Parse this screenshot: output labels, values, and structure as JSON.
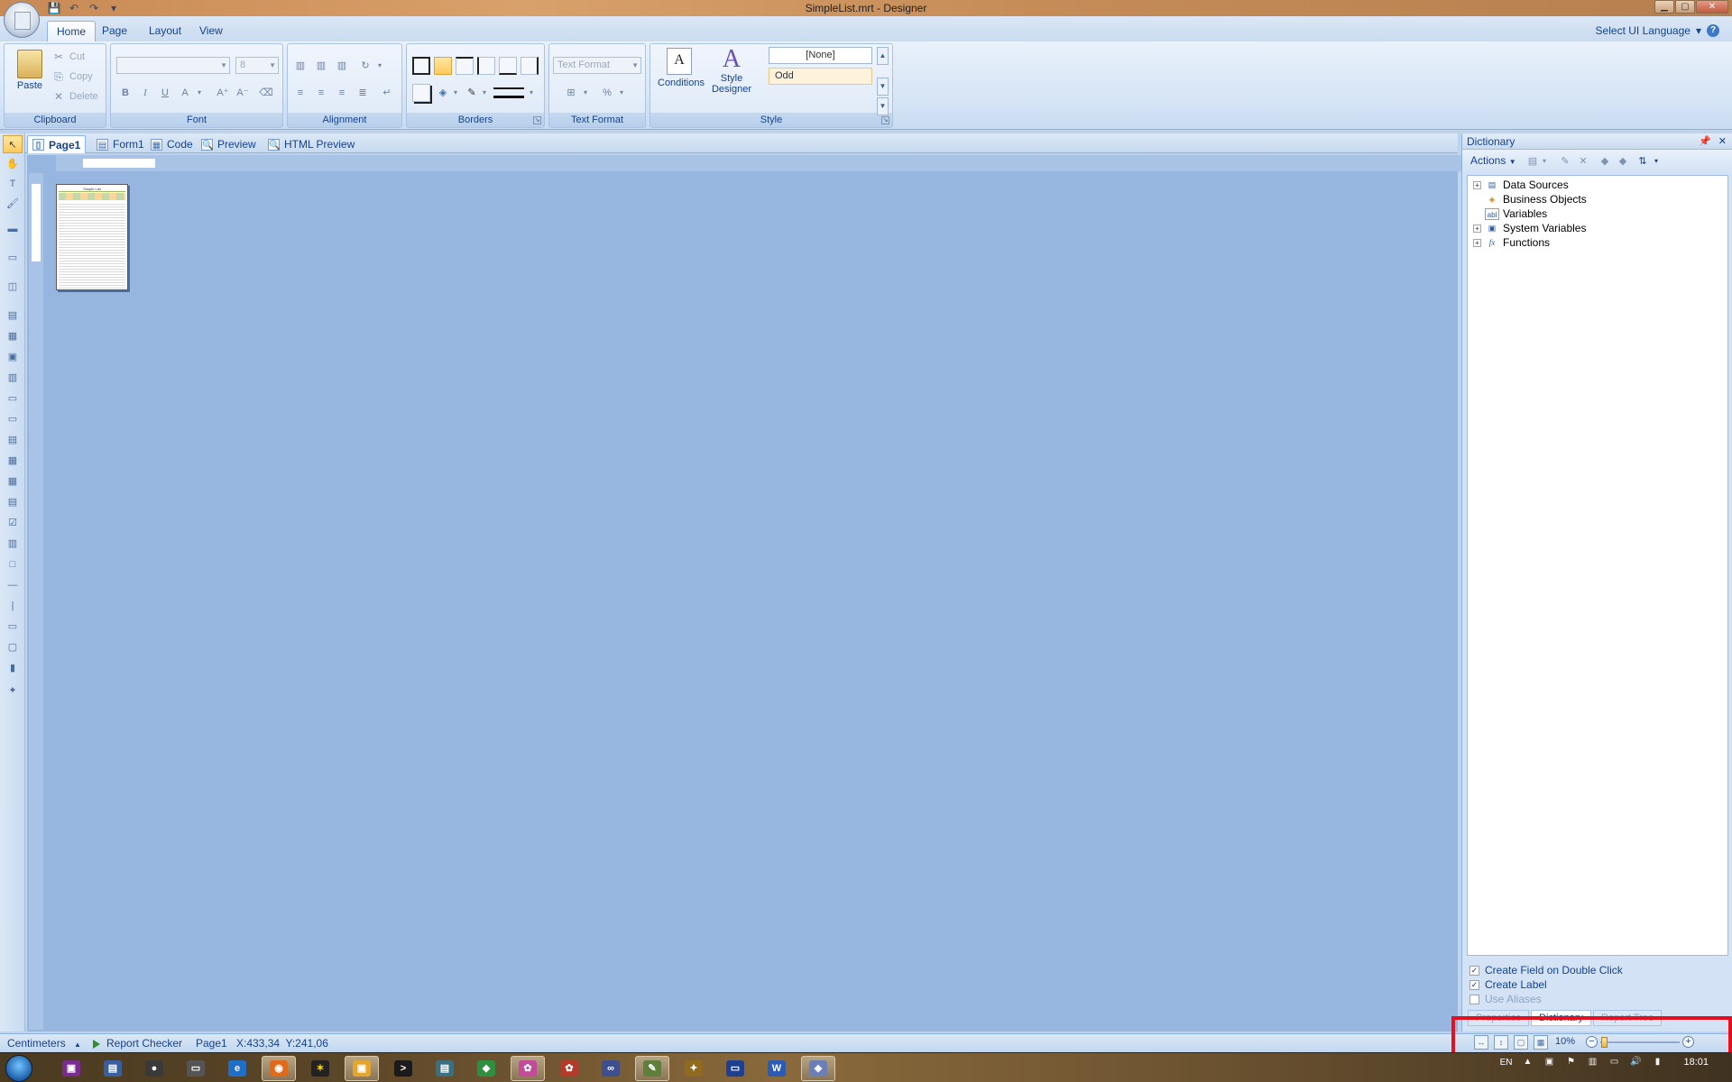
{
  "window": {
    "title": "SimpleList.mrt - Designer",
    "controls": {
      "minimize": "▁",
      "maximize": "▢",
      "close": "✕"
    }
  },
  "quick_access": [
    {
      "name": "save-icon",
      "glyph": "💾"
    },
    {
      "name": "undo-icon",
      "glyph": "↶"
    },
    {
      "name": "redo-icon",
      "glyph": "↷"
    },
    {
      "name": "customize-qat-icon",
      "glyph": "▾"
    }
  ],
  "ribbon_tabs": [
    {
      "label": "Home",
      "active": true
    },
    {
      "label": "Page",
      "active": false
    },
    {
      "label": "Layout",
      "active": false
    },
    {
      "label": "View",
      "active": false
    }
  ],
  "select_ui_language": "Select UI Language",
  "help_glyph": "?",
  "ribbon": {
    "clipboard": {
      "label": "Clipboard",
      "paste": "Paste",
      "cut": "Cut",
      "copy": "Copy",
      "delete": "Delete"
    },
    "font": {
      "label": "Font",
      "font_name": "",
      "font_size": "8",
      "bold": "B",
      "italic": "I",
      "underline": "U",
      "color_glyph": "A",
      "grow_glyph": "A⁺",
      "shrink_glyph": "A⁻"
    },
    "alignment": {
      "label": "Alignment"
    },
    "borders": {
      "label": "Borders"
    },
    "text_format": {
      "label": "Text Format",
      "value": "Text Format"
    },
    "style": {
      "label": "Style",
      "conditions": "Conditions",
      "style_designer_line1": "Style",
      "style_designer_line2": "Designer",
      "style_none": "[None]",
      "style_odd": "Odd"
    }
  },
  "document_tabs": [
    {
      "label": "Page1",
      "icon": "page-icon",
      "active": true
    },
    {
      "label": "Form1",
      "icon": "form-icon",
      "active": false
    },
    {
      "label": "Code",
      "icon": "code-icon",
      "active": false
    },
    {
      "label": "Preview",
      "icon": "preview-icon",
      "active": false
    },
    {
      "label": "HTML Preview",
      "icon": "html-preview-icon",
      "active": false
    }
  ],
  "page_thumbnail": {
    "title": "Simple List"
  },
  "dictionary": {
    "title": "Dictionary",
    "pin_glyph": "📌",
    "close_glyph": "✕",
    "actions_label": "Actions",
    "tree": [
      {
        "label": "Data Sources",
        "expandable": true,
        "icon": "data-sources-icon",
        "glyph": "▤"
      },
      {
        "label": "Business Objects",
        "expandable": false,
        "icon": "business-objects-icon",
        "glyph": "◈"
      },
      {
        "label": "Variables",
        "expandable": false,
        "icon": "variables-icon",
        "glyph": "abl"
      },
      {
        "label": "System Variables",
        "expandable": true,
        "icon": "system-variables-icon",
        "glyph": "▣"
      },
      {
        "label": "Functions",
        "expandable": true,
        "icon": "functions-icon",
        "glyph": "fx"
      }
    ],
    "options": [
      {
        "label": "Create Field on Double Click",
        "checked": true
      },
      {
        "label": "Create Label",
        "checked": true
      },
      {
        "label": "Use Aliases",
        "checked": false
      }
    ],
    "bottom_tabs": [
      {
        "label": "Properties",
        "active": false
      },
      {
        "label": "Dictionary",
        "active": true
      },
      {
        "label": "Report Tree",
        "active": false
      }
    ]
  },
  "statusbar": {
    "units": "Centimeters",
    "report_checker": "Report Checker",
    "page": "Page1",
    "coords": "X:433,34  Y:241,06",
    "zoom": "10%",
    "zoom_level": 0.05
  },
  "taskbar": {
    "apps": [
      "app-1",
      "app-2",
      "app-3",
      "app-4",
      "app-5",
      "app-6",
      "app-7",
      "app-8",
      "app-9",
      "app-10",
      "app-11",
      "app-12",
      "app-13",
      "app-14",
      "app-15",
      "app-16",
      "app-17",
      "app-18",
      "app-19"
    ],
    "language": "EN",
    "time": "18:01"
  }
}
